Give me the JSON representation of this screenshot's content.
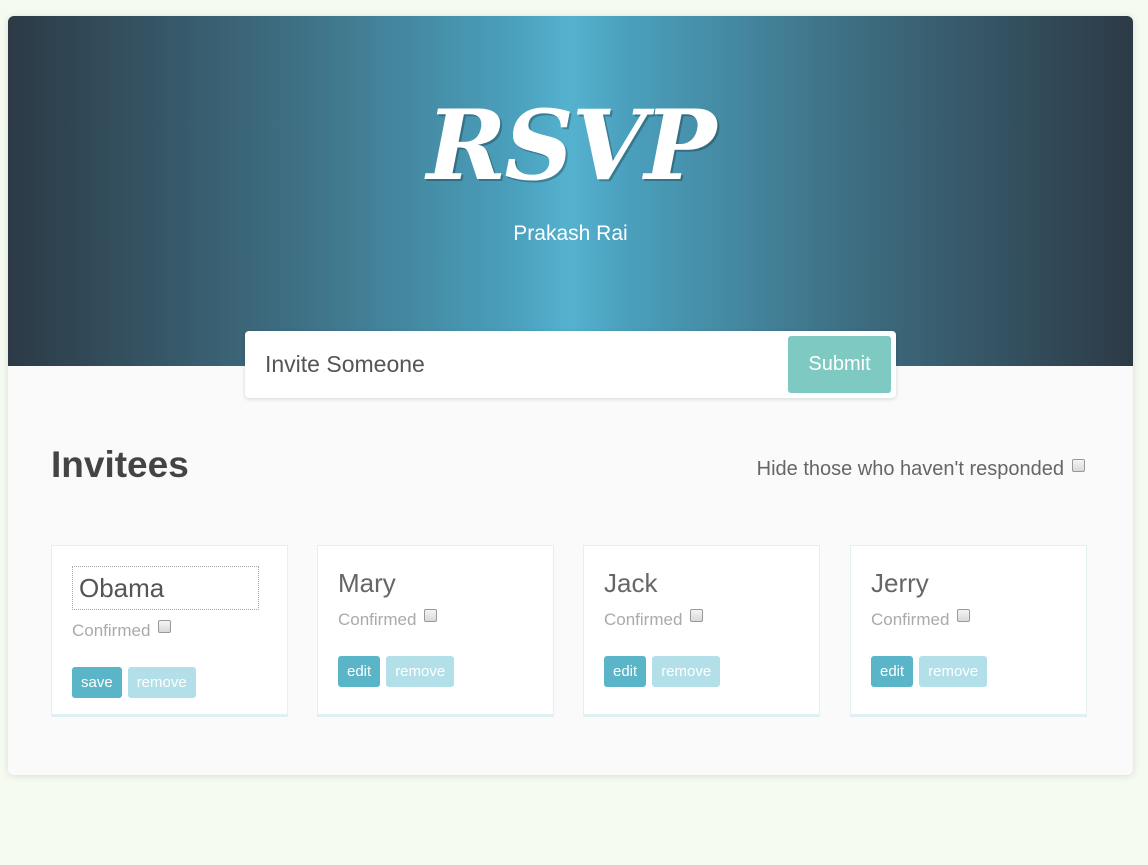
{
  "header": {
    "logo": "RSVP",
    "subtitle": "Prakash Rai"
  },
  "invite_form": {
    "placeholder": "Invite Someone",
    "submit_label": "Submit"
  },
  "main": {
    "title": "Invitees",
    "filter_label": "Hide those who haven't responded",
    "filter_checked": false
  },
  "invitees": [
    {
      "name": "Obama",
      "editing": true,
      "confirmed_label": "Confirmed",
      "confirmed": false,
      "primary_label": "save",
      "remove_label": "remove"
    },
    {
      "name": "Mary",
      "editing": false,
      "confirmed_label": "Confirmed",
      "confirmed": false,
      "primary_label": "edit",
      "remove_label": "remove"
    },
    {
      "name": "Jack",
      "editing": false,
      "confirmed_label": "Confirmed",
      "confirmed": false,
      "primary_label": "edit",
      "remove_label": "remove"
    },
    {
      "name": "Jerry",
      "editing": false,
      "confirmed_label": "Confirmed",
      "confirmed": false,
      "primary_label": "edit",
      "remove_label": "remove"
    }
  ],
  "colors": {
    "accent": "#5bb5c9",
    "accent_light": "#b3dfe8",
    "submit": "#7ecac2",
    "page_background": "#f5fbf1"
  }
}
